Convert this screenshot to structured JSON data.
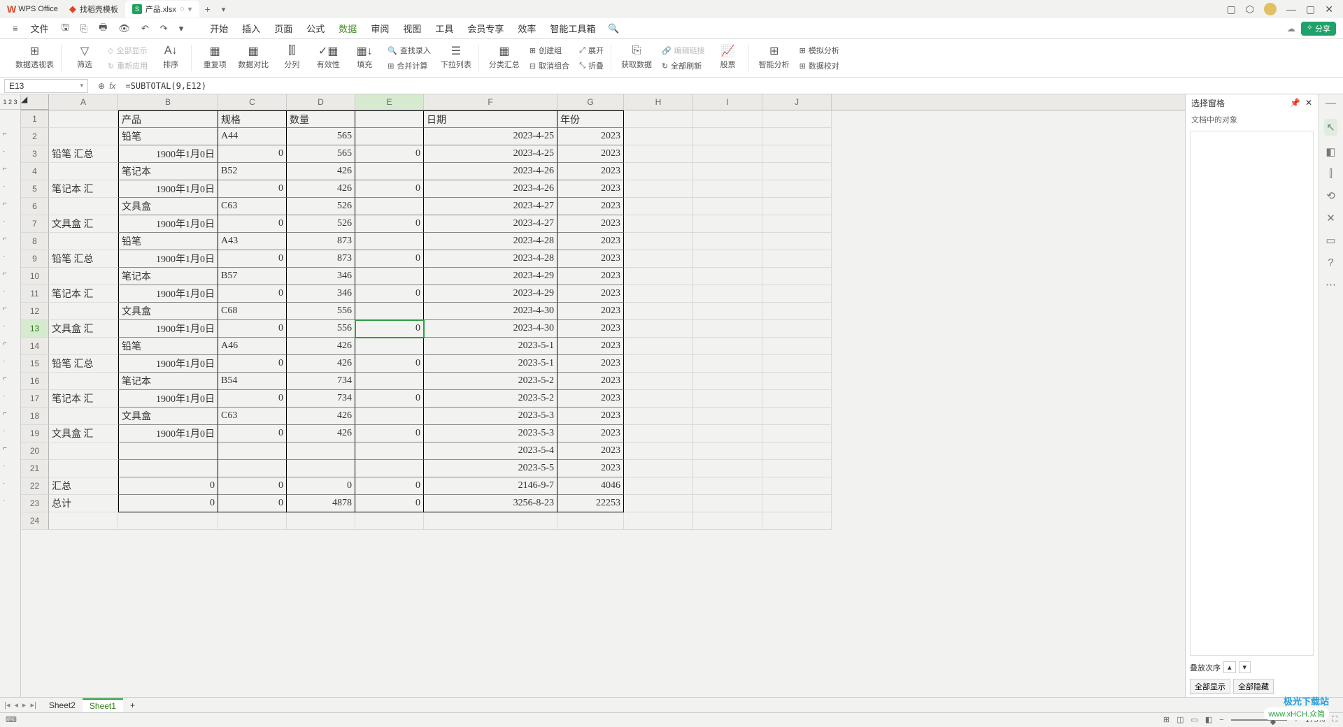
{
  "titlebar": {
    "app_name": "WPS Office",
    "tab1": "找稻壳模板",
    "tab2": "产品.xlsx"
  },
  "menubar": {
    "file": "文件",
    "items": [
      "开始",
      "插入",
      "页面",
      "公式",
      "数据",
      "审阅",
      "视图",
      "工具",
      "会员专享",
      "效率",
      "智能工具箱"
    ],
    "share": "分享"
  },
  "ribbon": {
    "pivot": "数据透视表",
    "filter": "筛选",
    "show_all": "全部显示",
    "reapply": "重新应用",
    "sort": "排序",
    "dup": "重复项",
    "compare": "数据对比",
    "split_col": "分列",
    "validity": "有效性",
    "fill": "填充",
    "find_entry": "查找录入",
    "consolidate": "合并计算",
    "to_col": "下拉列表",
    "subtotal": "分类汇总",
    "group": "创建组",
    "ungroup": "取消组合",
    "expand": "展开",
    "collapse": "折叠",
    "getdata": "获取数据",
    "editlink": "编辑链接",
    "refresh": "全部刷新",
    "stocks": "股票",
    "smart": "智能分析",
    "whatif": "模拟分析",
    "datacheck": "数据校对"
  },
  "formula_bar": {
    "name_box": "E13",
    "fx": "fx",
    "formula": "=SUBTOTAL(9,E12)"
  },
  "columns": [
    "A",
    "B",
    "C",
    "D",
    "E",
    "F",
    "G",
    "H",
    "I",
    "J"
  ],
  "rows": [
    {
      "n": 1,
      "A": "",
      "B": "产品",
      "C": "规格",
      "D": "数量",
      "E": "",
      "F": "日期",
      "G": "年份"
    },
    {
      "n": 2,
      "A": "",
      "B": "铅笔",
      "C": "A44",
      "D": "565",
      "E": "",
      "F": "2023-4-25",
      "G": "2023"
    },
    {
      "n": 3,
      "A": "铅笔 汇总",
      "B": "1900年1月0日",
      "C": "0",
      "D": "565",
      "E": "0",
      "F": "2023-4-25",
      "G": "2023"
    },
    {
      "n": 4,
      "A": "",
      "B": "笔记本",
      "C": "B52",
      "D": "426",
      "E": "",
      "F": "2023-4-26",
      "G": "2023"
    },
    {
      "n": 5,
      "A": "笔记本 汇",
      "B": "1900年1月0日",
      "C": "0",
      "D": "426",
      "E": "0",
      "F": "2023-4-26",
      "G": "2023"
    },
    {
      "n": 6,
      "A": "",
      "B": "文具盒",
      "C": "C63",
      "D": "526",
      "E": "",
      "F": "2023-4-27",
      "G": "2023"
    },
    {
      "n": 7,
      "A": "文具盒 汇",
      "B": "1900年1月0日",
      "C": "0",
      "D": "526",
      "E": "0",
      "F": "2023-4-27",
      "G": "2023"
    },
    {
      "n": 8,
      "A": "",
      "B": "铅笔",
      "C": "A43",
      "D": "873",
      "E": "",
      "F": "2023-4-28",
      "G": "2023"
    },
    {
      "n": 9,
      "A": "铅笔 汇总",
      "B": "1900年1月0日",
      "C": "0",
      "D": "873",
      "E": "0",
      "F": "2023-4-28",
      "G": "2023"
    },
    {
      "n": 10,
      "A": "",
      "B": "笔记本",
      "C": "B57",
      "D": "346",
      "E": "",
      "F": "2023-4-29",
      "G": "2023"
    },
    {
      "n": 11,
      "A": "笔记本 汇",
      "B": "1900年1月0日",
      "C": "0",
      "D": "346",
      "E": "0",
      "F": "2023-4-29",
      "G": "2023"
    },
    {
      "n": 12,
      "A": "",
      "B": "文具盒",
      "C": "C68",
      "D": "556",
      "E": "",
      "F": "2023-4-30",
      "G": "2023"
    },
    {
      "n": 13,
      "A": "文具盒 汇",
      "B": "1900年1月0日",
      "C": "0",
      "D": "556",
      "E": "0",
      "F": "2023-4-30",
      "G": "2023"
    },
    {
      "n": 14,
      "A": "",
      "B": "铅笔",
      "C": "A46",
      "D": "426",
      "E": "",
      "F": "2023-5-1",
      "G": "2023"
    },
    {
      "n": 15,
      "A": "铅笔 汇总",
      "B": "1900年1月0日",
      "C": "0",
      "D": "426",
      "E": "0",
      "F": "2023-5-1",
      "G": "2023"
    },
    {
      "n": 16,
      "A": "",
      "B": "笔记本",
      "C": "B54",
      "D": "734",
      "E": "",
      "F": "2023-5-2",
      "G": "2023"
    },
    {
      "n": 17,
      "A": "笔记本 汇",
      "B": "1900年1月0日",
      "C": "0",
      "D": "734",
      "E": "0",
      "F": "2023-5-2",
      "G": "2023"
    },
    {
      "n": 18,
      "A": "",
      "B": "文具盒",
      "C": "C63",
      "D": "426",
      "E": "",
      "F": "2023-5-3",
      "G": "2023"
    },
    {
      "n": 19,
      "A": "文具盒 汇",
      "B": "1900年1月0日",
      "C": "0",
      "D": "426",
      "E": "0",
      "F": "2023-5-3",
      "G": "2023"
    },
    {
      "n": 20,
      "A": "",
      "B": "",
      "C": "",
      "D": "",
      "E": "",
      "F": "2023-5-4",
      "G": "2023"
    },
    {
      "n": 21,
      "A": "",
      "B": "",
      "C": "",
      "D": "",
      "E": "",
      "F": "2023-5-5",
      "G": "2023"
    },
    {
      "n": 22,
      "A": " 汇总",
      "B": "0",
      "C": "0",
      "D": "0",
      "E": "0",
      "F": "2146-9-7",
      "G": "4046"
    },
    {
      "n": 23,
      "A": "总计",
      "B": "0",
      "C": "0",
      "D": "4878",
      "E": "0",
      "F": "3256-8-23",
      "G": "22253"
    },
    {
      "n": 24,
      "A": "",
      "B": "",
      "C": "",
      "D": "",
      "E": "",
      "F": "",
      "G": ""
    }
  ],
  "right_panel": {
    "title": "选择窗格",
    "subtitle": "文档中的对象",
    "order": "叠放次序",
    "show_all": "全部显示",
    "hide_all": "全部隐藏"
  },
  "sheet_tabs": {
    "sheet2": "Sheet2",
    "sheet1": "Sheet1"
  },
  "statusbar": {
    "zoom": "175%"
  },
  "outline_levels": "1 2 3",
  "watermark": {
    "line1": "极光下载站",
    "line2": "www.xHCH.众简"
  }
}
